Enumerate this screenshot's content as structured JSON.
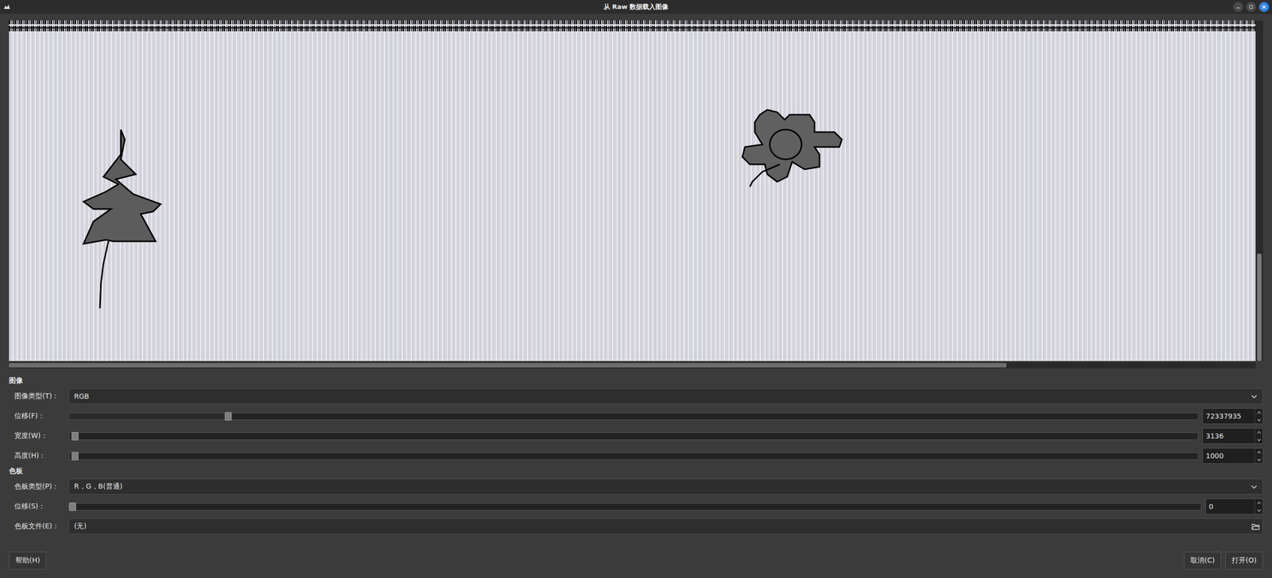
{
  "window": {
    "title": "从 Raw 数据载入图像"
  },
  "preview": {
    "h_scroll": {
      "level": 0.8
    },
    "v_scroll": {
      "level": 1
    }
  },
  "sections": [
    {
      "title": "图像",
      "rows": [
        {
          "kind": "combo",
          "label": "图像类型(T)：",
          "value": "RGB"
        },
        {
          "kind": "slider",
          "label": "位移(F)：",
          "level": 0.138,
          "value": "72337935"
        },
        {
          "kind": "slider",
          "label": "宽度(W)：",
          "level": 0.002,
          "value": "3136"
        },
        {
          "kind": "slider",
          "label": "高度(H)：",
          "level": 0.002,
          "value": "1000"
        }
      ]
    },
    {
      "title": "色板",
      "rows": [
        {
          "kind": "combo",
          "label": "色板类型(P)：",
          "value": "R，G，B(普通)"
        },
        {
          "kind": "slider",
          "label": "位移(S)：",
          "level": 0.0,
          "value": "0"
        },
        {
          "kind": "file",
          "label": "色板文件(E)：",
          "value": "(无)"
        }
      ]
    }
  ],
  "buttons": {
    "left": [
      "帮助(H)"
    ],
    "right": [
      "取消(C)",
      "打开(O)"
    ]
  }
}
